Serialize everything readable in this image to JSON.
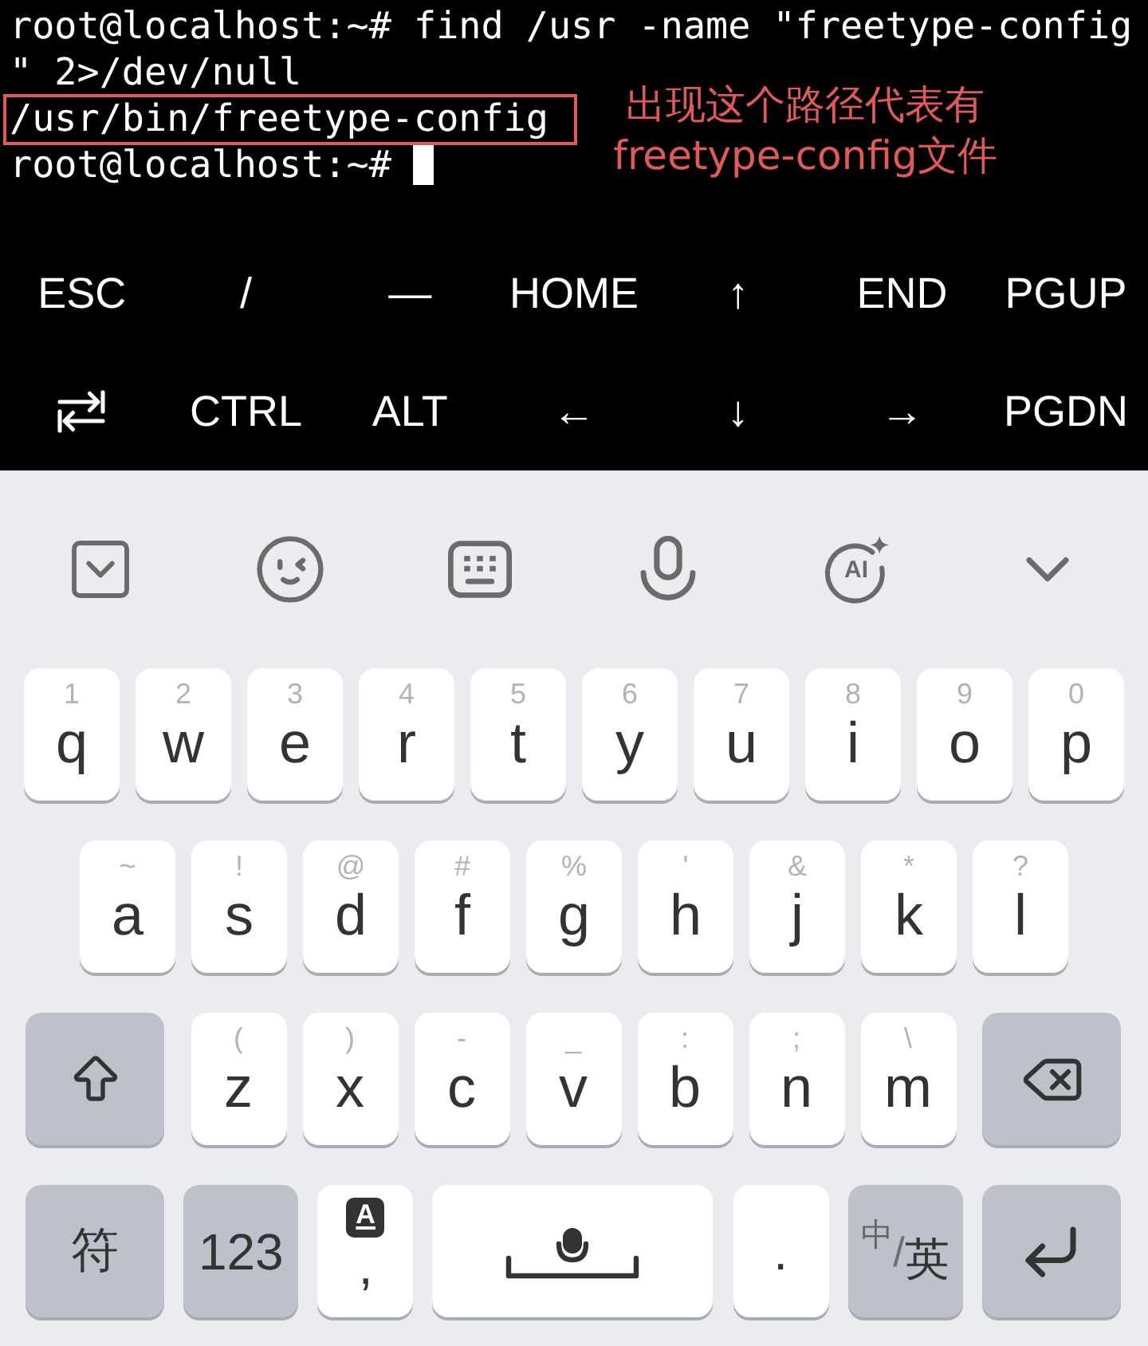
{
  "terminal": {
    "lines": [
      {
        "text": "root@localhost:~# find /usr -name \"freetype-config",
        "highlighted": false,
        "cursor": false
      },
      {
        "text": "\" 2>/dev/null",
        "highlighted": false,
        "cursor": false
      },
      {
        "text": "/usr/bin/freetype-config",
        "highlighted": true,
        "cursor": false
      },
      {
        "text": "root@localhost:~#",
        "highlighted": false,
        "cursor": true
      }
    ],
    "annotation": {
      "lines": [
        "出现这个路径代表有",
        "freetype-config文件"
      ]
    }
  },
  "extra_keys": {
    "rows": [
      {
        "keys": [
          {
            "kind": "text",
            "label": "ESC"
          },
          {
            "kind": "text",
            "label": "/"
          },
          {
            "kind": "text",
            "label": "—"
          },
          {
            "kind": "text",
            "label": "HOME"
          },
          {
            "kind": "text",
            "label": "↑"
          },
          {
            "kind": "text",
            "label": "END"
          },
          {
            "kind": "text",
            "label": "PGUP"
          }
        ]
      },
      {
        "keys": [
          {
            "kind": "tab"
          },
          {
            "kind": "text",
            "label": "CTRL"
          },
          {
            "kind": "text",
            "label": "ALT"
          },
          {
            "kind": "text",
            "label": "←"
          },
          {
            "kind": "text",
            "label": "↓"
          },
          {
            "kind": "text",
            "label": "→"
          },
          {
            "kind": "text",
            "label": "PGDN"
          }
        ]
      }
    ]
  },
  "keyboard": {
    "toolbar": {
      "ai_label": "AI"
    },
    "rows": [
      {
        "keys": [
          {
            "kind": "letter",
            "hint": "1",
            "label": "q"
          },
          {
            "kind": "letter",
            "hint": "2",
            "label": "w"
          },
          {
            "kind": "letter",
            "hint": "3",
            "label": "e"
          },
          {
            "kind": "letter",
            "hint": "4",
            "label": "r"
          },
          {
            "kind": "letter",
            "hint": "5",
            "label": "t"
          },
          {
            "kind": "letter",
            "hint": "6",
            "label": "y"
          },
          {
            "kind": "letter",
            "hint": "7",
            "label": "u"
          },
          {
            "kind": "letter",
            "hint": "8",
            "label": "i"
          },
          {
            "kind": "letter",
            "hint": "9",
            "label": "o"
          },
          {
            "kind": "letter",
            "hint": "0",
            "label": "p"
          }
        ]
      },
      {
        "keys": [
          {
            "kind": "letter",
            "hint": "~",
            "label": "a"
          },
          {
            "kind": "letter",
            "hint": "!",
            "label": "s"
          },
          {
            "kind": "letter",
            "hint": "@",
            "label": "d"
          },
          {
            "kind": "letter",
            "hint": "#",
            "label": "f"
          },
          {
            "kind": "letter",
            "hint": "%",
            "label": "g"
          },
          {
            "kind": "letter",
            "hint": "'",
            "label": "h"
          },
          {
            "kind": "letter",
            "hint": "&",
            "label": "j"
          },
          {
            "kind": "letter",
            "hint": "*",
            "label": "k"
          },
          {
            "kind": "letter",
            "hint": "?",
            "label": "l"
          }
        ]
      },
      {
        "keys": [
          {
            "kind": "shift"
          },
          {
            "kind": "letter",
            "hint": "(",
            "label": "z"
          },
          {
            "kind": "letter",
            "hint": ")",
            "label": "x"
          },
          {
            "kind": "letter",
            "hint": "-",
            "label": "c"
          },
          {
            "kind": "letter",
            "hint": "_",
            "label": "v"
          },
          {
            "kind": "letter",
            "hint": ":",
            "label": "b"
          },
          {
            "kind": "letter",
            "hint": ";",
            "label": "n"
          },
          {
            "kind": "letter",
            "hint": "\\",
            "label": "m"
          },
          {
            "kind": "backspace"
          }
        ]
      },
      {
        "keys": [
          {
            "kind": "symbols",
            "label": "符"
          },
          {
            "kind": "numbers",
            "label": "123"
          },
          {
            "kind": "comma",
            "badge": "A",
            "label": ","
          },
          {
            "kind": "space"
          },
          {
            "kind": "period",
            "label": "."
          },
          {
            "kind": "language",
            "options": [
              {
                "label": "中",
                "selected": false
              },
              {
                "label": "英",
                "selected": true
              }
            ],
            "separator": "/"
          },
          {
            "kind": "enter"
          }
        ]
      }
    ]
  }
}
